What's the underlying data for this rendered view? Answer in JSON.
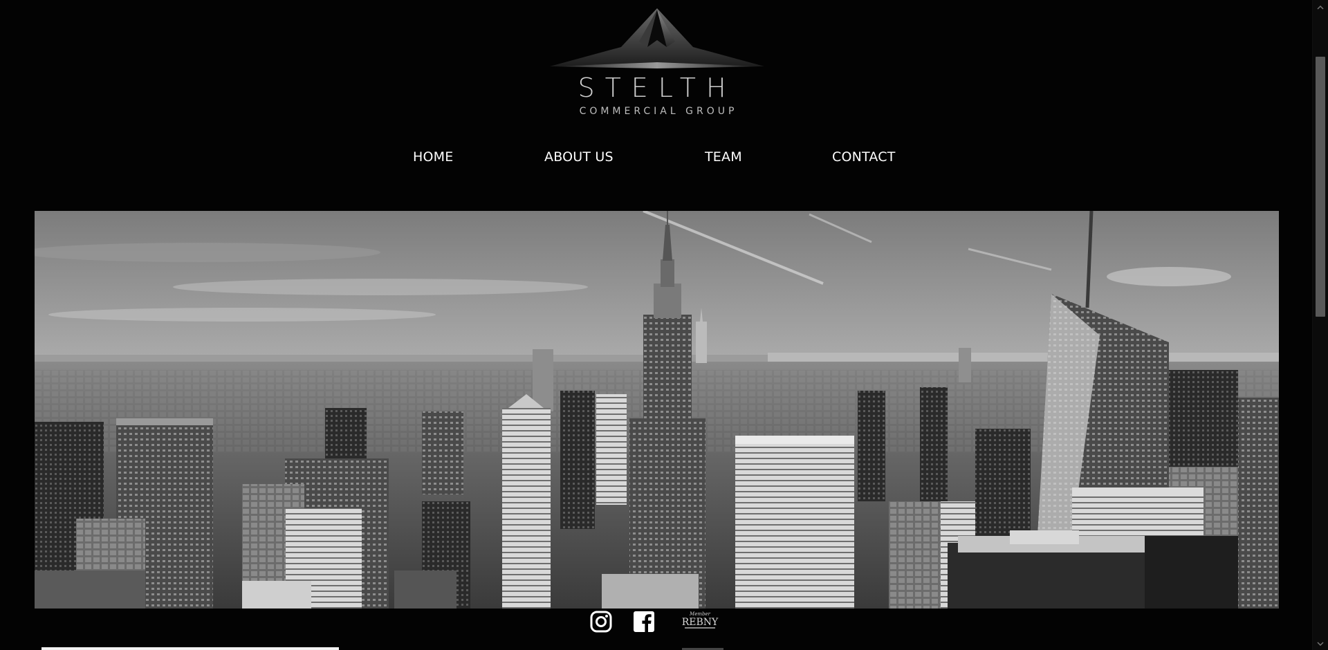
{
  "brand": {
    "name": "STELTH",
    "tagline": "COMMERCIAL GROUP"
  },
  "nav": {
    "items": [
      {
        "label": "HOME"
      },
      {
        "label": "ABOUT US"
      },
      {
        "label": "TEAM"
      },
      {
        "label": "CONTACT"
      }
    ]
  },
  "social": {
    "instagram_icon": "instagram-icon",
    "facebook_icon": "facebook-icon",
    "rebny": {
      "member_text": "Member",
      "name": "REBNY"
    }
  },
  "colors": {
    "background": "#030303",
    "text": "#ffffff",
    "logo_text": "#cfcfcf"
  }
}
